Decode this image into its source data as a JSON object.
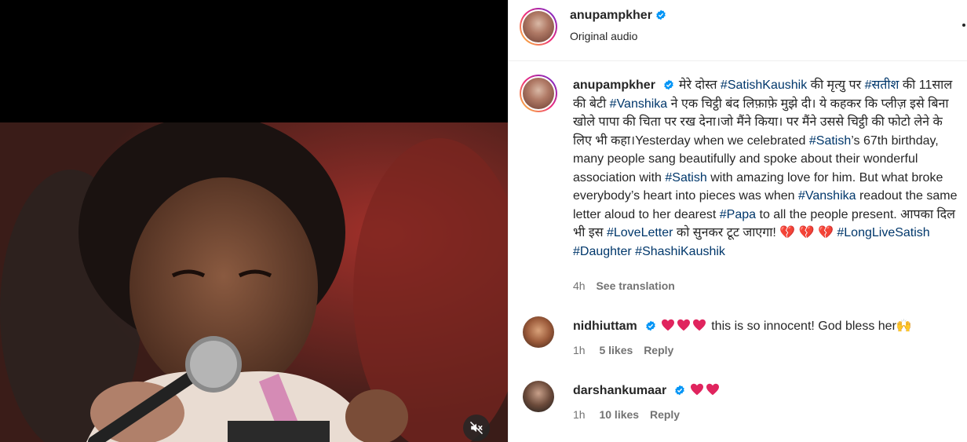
{
  "post": {
    "username": "anupampkher",
    "audio": "Original audio"
  },
  "caption": {
    "username": "anupampkher",
    "segments": [
      {
        "t": "मेरे दोस्त ",
        "h": false
      },
      {
        "t": "#SatishKaushik",
        "h": true
      },
      {
        "t": " की मृत्यु पर ",
        "h": false
      },
      {
        "t": "#सतीश",
        "h": true
      },
      {
        "t": " की 11साल की बेटी ",
        "h": false
      },
      {
        "t": "#Vanshika",
        "h": true
      },
      {
        "t": " ने एक चिट्ठी बंद लिफ़ाफ़े मुझे दी। ये कहकर कि प्लीज़ इसे बिना खोले पापा की चिता पर रख देना।जो मैंने किया। पर मैंने उससे चिट्ठी की फोटो लेने के लिए भी कहा।Yesterday when we celebrated ",
        "h": false
      },
      {
        "t": "#Satish",
        "h": true
      },
      {
        "t": "’s 67th birthday, many people sang beautifully and spoke about their wonderful association with ",
        "h": false
      },
      {
        "t": "#Satish",
        "h": true
      },
      {
        "t": " with amazing love for him. But what broke everybody’s heart into pieces was when ",
        "h": false
      },
      {
        "t": "#Vanshika",
        "h": true
      },
      {
        "t": " readout the same letter aloud to her dearest ",
        "h": false
      },
      {
        "t": "#Papa",
        "h": true
      },
      {
        "t": " to all the people present. आपका दिल भी इस ",
        "h": false
      },
      {
        "t": "#LoveLetter",
        "h": true
      },
      {
        "t": " को सुनकर टूट जाएगा! 💔 💔 💔 ",
        "h": false
      },
      {
        "t": "#LongLiveSatish",
        "h": true
      },
      {
        "t": " ",
        "h": false
      },
      {
        "t": "#Daughter",
        "h": true
      },
      {
        "t": " ",
        "h": false
      },
      {
        "t": "#ShashiKaushik",
        "h": true
      }
    ],
    "time": "4h",
    "see_translation": "See translation"
  },
  "comments": [
    {
      "username": "nidhiuttam",
      "text": "this is so innocent! God bless her🙌",
      "hearts": 3,
      "time": "1h",
      "likes": "5 likes",
      "reply": "Reply"
    },
    {
      "username": "darshankumaar",
      "text": "",
      "hearts": 2,
      "time": "1h",
      "likes": "10 likes",
      "reply": "Reply"
    }
  ],
  "colors": {
    "hashtag": "#00376b",
    "verified": "#0095f6",
    "muted_text": "#737373",
    "heart": "#e0245e"
  },
  "icons": [
    "verified-badge-icon",
    "more-options-icon",
    "mute-icon",
    "red-heart-icon"
  ]
}
